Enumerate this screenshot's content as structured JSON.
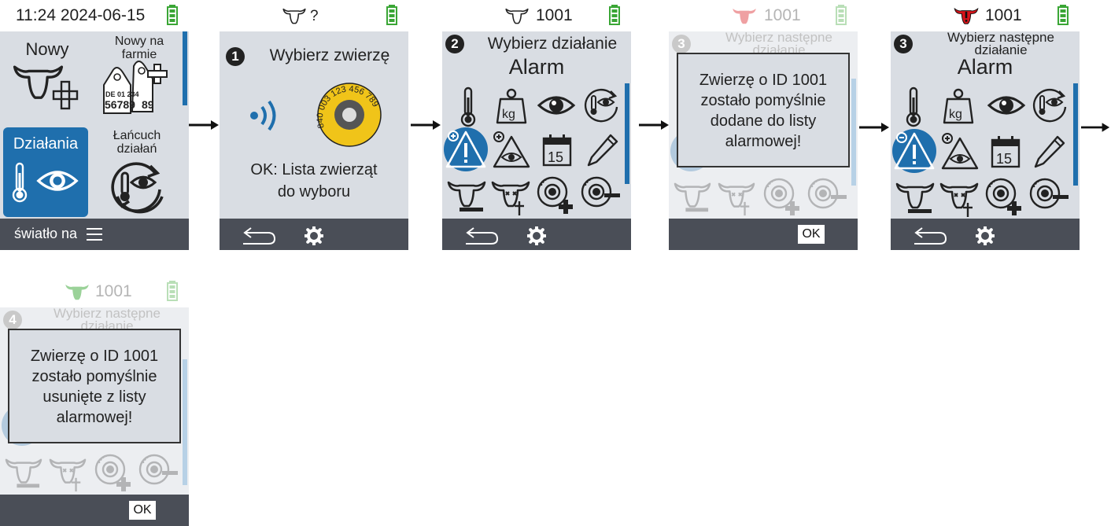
{
  "screens": {
    "s1": {
      "status": "11:24 2024-06-15",
      "tiles": {
        "nowy": "Nowy",
        "nowy_na_farmie": "Nowy na farmie",
        "dzialania": "Działania",
        "lancuch": "Łańcuch działań"
      },
      "tag_text_1": "DE 01 234",
      "tag_text_2": "56789",
      "tag_text_3": "89",
      "footer": "światło na",
      "icons": [
        "cow-add-icon",
        "ear-tag-add-icon",
        "thermometer-icon",
        "eye-icon",
        "action-chain-icon",
        "menu-icon",
        "battery-icon"
      ]
    },
    "s2": {
      "status": "?",
      "step": "1",
      "title": "Wybierz zwierzę",
      "prompt": "OK: Lista zwierząt do wyboru",
      "prompt_l1": "OK: Lista zwierząt",
      "prompt_l2": "do wyboru",
      "tag_number": "840 003 123 456 789",
      "icons": [
        "cow-icon",
        "rfid-scan-icon",
        "electronic-tag-icon",
        "back-icon",
        "settings-icon"
      ]
    },
    "s3": {
      "status": "1001",
      "step": "2",
      "title": "Wybierz działanie",
      "subtitle": "Alarm",
      "kg": "kg",
      "cal": "15",
      "icons": [
        "thermometer-icon",
        "weight-icon",
        "eye-icon",
        "temperature-observe-icon",
        "alarm-add-icon",
        "observe-add-icon",
        "calendar-icon",
        "pencil-icon",
        "cow-remove-icon",
        "cow-dead-icon",
        "tag-add-icon",
        "tag-remove-icon",
        "back-icon",
        "settings-icon"
      ]
    },
    "s4": {
      "status": "1001",
      "step": "3",
      "title_l1": "Wybierz następne",
      "title_l2": "działanie",
      "dialog_l1": "Zwierzę o ID 1001",
      "dialog_l2": "zostało pomyślnie",
      "dialog_l3": "dodane do listy",
      "dialog_l4": "alarmowej!",
      "ok": "OK"
    },
    "s5": {
      "status": "1001",
      "step": "3",
      "title_l1": "Wybierz następne",
      "title_l2": "działanie",
      "subtitle": "Alarm",
      "kg": "kg",
      "cal": "15"
    },
    "s6": {
      "status": "1001",
      "step": "4",
      "title_l1": "Wybierz następne",
      "title_l2": "działanie",
      "dialog_l1": "Zwierzę o ID 1001",
      "dialog_l2": "zostało pomyślnie",
      "dialog_l3": "usunięte z listy",
      "dialog_l4": "alarmowej!",
      "ok": "OK"
    }
  },
  "colors": {
    "accent": "#1f6fad",
    "body": "#d9dde3",
    "footer": "#4a4e57",
    "battery": "#3aa635",
    "alarm_red": "#d8141a"
  }
}
